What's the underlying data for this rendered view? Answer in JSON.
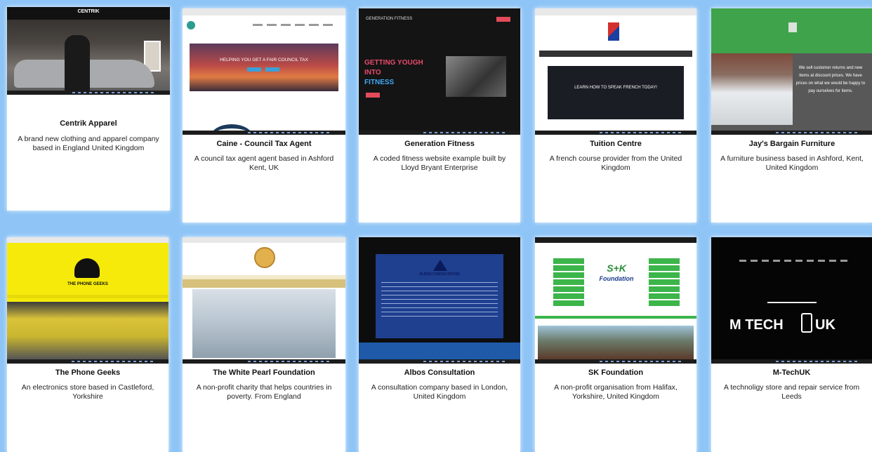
{
  "cards": [
    {
      "title": "Centrik Apparel",
      "desc": "A brand new clothing and apparel company based in England United Kingdom",
      "shot": {
        "brand": "CENTRIK"
      }
    },
    {
      "title": "Caine - Council Tax Agent",
      "desc": "A council tax agent agent based in Ashford Kent, UK",
      "shot": {
        "hero": "HELPING YOU GET A FAIR COUNCIL TAX"
      }
    },
    {
      "title": "Generation Fitness",
      "desc": "A coded fitness website example built by Lloyd Bryant Enterprise",
      "shot": {
        "nav": "GENERATION FITNESS",
        "l1": "GETTING YOUGH",
        "l2": "INTO",
        "l3": "FITNESS"
      }
    },
    {
      "title": "Tuition Centre",
      "desc": "A french course provider from the United Kingdom",
      "shot": {
        "hero": "LEARN HOW TO SPEAK FRENCH TODAY!"
      }
    },
    {
      "title": "Jay's Bargain Furniture",
      "desc": "A furniture business based in Ashford, Kent, United Kingdom",
      "shot": {
        "text": "We sell customer returns and new items at discount prices. We have prices on what we would be happy to pay ourselves for items."
      }
    },
    {
      "title": "The Phone Geeks",
      "desc": "An electronics store based in Castleford, Yorkshire",
      "shot": {
        "brand": "THE PHONE GEEKS"
      }
    },
    {
      "title": "The White Pearl Foundation",
      "desc": "A non-profit charity that helps countries in poverty. From England",
      "shot": {}
    },
    {
      "title": "Albos Consultation",
      "desc": "A consultation company based in London, United Kingdom",
      "shot": {
        "brand": "ALBOS CONSULTATION"
      }
    },
    {
      "title": "SK Foundation",
      "desc": "A non-profit organisation from Halifax, Yorkshire, United Kingdom",
      "shot": {
        "logo": "S+K",
        "logo2": "Foundation"
      }
    },
    {
      "title": "M-TechUK",
      "desc": "A technoligy store and repair service from Leeds",
      "shot": {
        "brand1": "M TECH",
        "brand2": "UK"
      }
    }
  ]
}
